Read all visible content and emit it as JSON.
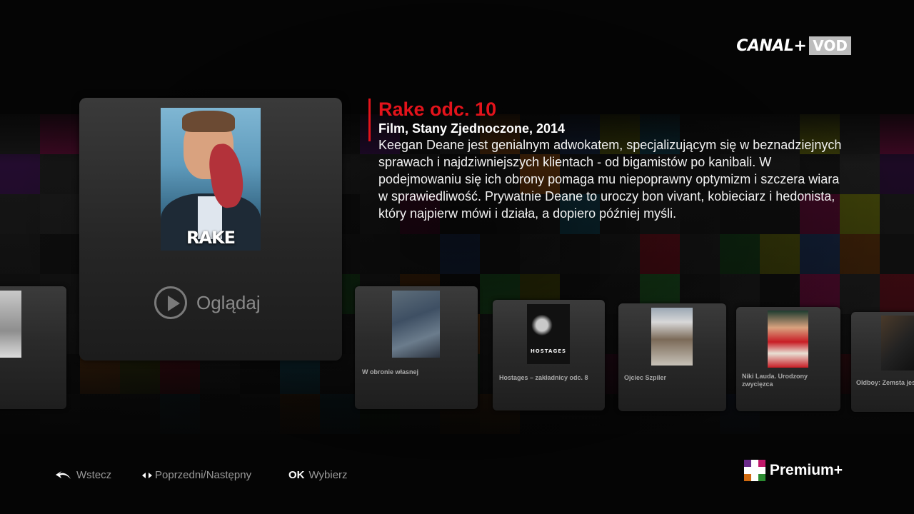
{
  "brand": {
    "canal": "CANAL+",
    "vod": "VOD"
  },
  "featured": {
    "poster_title": "RAKE",
    "watch_label": "Oglądaj"
  },
  "details": {
    "title": "Rake odc. 10",
    "meta": "Film, Stany Zjednoczone, 2014",
    "description": "Keegan Deane jest genialnym adwokatem, specjalizującym się w beznadziejnych sprawach i najdziwniejszych klientach - od bigamistów po kanibali. W podejmowaniu się ich obrony pomaga mu niepoprawny optymizm i szczera wiara w sprawiedliwość. Prywatnie Deane to uroczy bon vivant, kobieciarz i hedonista, który najpierw mówi i działa, a dopiero później myśli."
  },
  "carousel": [
    {
      "title": ""
    },
    {
      "title": "W obronie własnej"
    },
    {
      "title": "Hostages – zakładnicy odc. 8",
      "poster_text": "HOSTAGES"
    },
    {
      "title": "Ojciec Szpiler"
    },
    {
      "title": "Niki Lauda. Urodzony zwycięzca"
    },
    {
      "title": "Oldboy: Zemsta jest c"
    }
  ],
  "footer": {
    "back_label": "Wstecz",
    "prevnext_label": "Poprzedni/Następny",
    "ok_key": "OK",
    "ok_label": "Wybierz",
    "package": "Premium+"
  },
  "colors": {
    "accent": "#e3131b",
    "mosaic": [
      "#5a1a7a",
      "#b01060",
      "#d01830",
      "#d06a10",
      "#a8b010",
      "#2a8a30",
      "#1a7a9a",
      "#2a4a8a"
    ]
  }
}
